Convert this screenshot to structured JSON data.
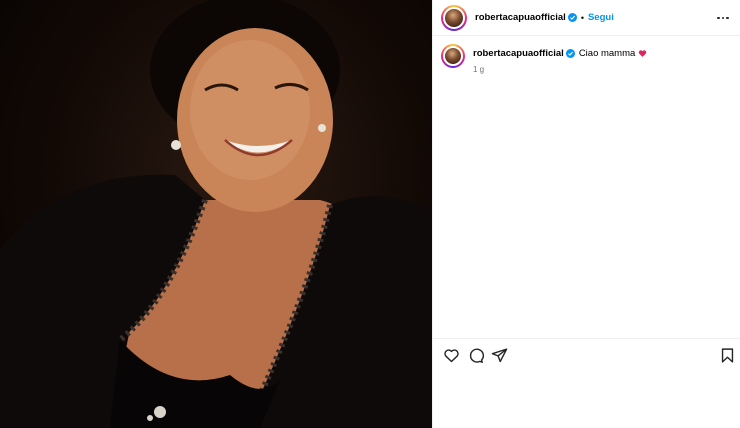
{
  "post": {
    "author": {
      "username": "robertacapuaofficial",
      "verified": true,
      "separator": "•",
      "follow_label": "Segui"
    },
    "caption": {
      "username": "robertacapuaofficial",
      "text": "Ciao mamma",
      "emoji": "heart",
      "timestamp": "1 g"
    },
    "actions": [
      "like-icon",
      "comment-icon",
      "share-icon",
      "save-icon"
    ]
  },
  "colors": {
    "link_blue": "#0095f6",
    "heart_red": "#e0245e",
    "muted": "#737373"
  }
}
